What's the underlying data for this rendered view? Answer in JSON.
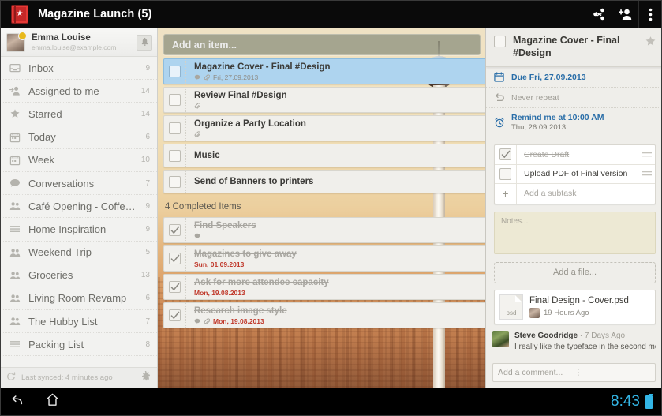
{
  "topbar": {
    "app_icon": "bookmark-star-icon",
    "title": "Magazine Launch (5)",
    "actions": [
      {
        "name": "share-icon",
        "label": "Share"
      },
      {
        "name": "add-person-icon",
        "label": "Add person"
      },
      {
        "name": "overflow-menu-icon",
        "label": "More options"
      }
    ]
  },
  "sidebar": {
    "profile": {
      "name": "Emma Louise",
      "email": "emma.louise@example.com",
      "notifications_icon": "bell-icon"
    },
    "items": [
      {
        "label": "Inbox",
        "count": "9",
        "icon": "inbox-icon"
      },
      {
        "label": "Assigned to me",
        "count": "14",
        "icon": "assigned-person-icon"
      },
      {
        "label": "Starred",
        "count": "14",
        "icon": "star-icon"
      },
      {
        "label": "Today",
        "count": "6",
        "icon": "calendar-icon"
      },
      {
        "label": "Week",
        "count": "10",
        "icon": "calendar-icon"
      },
      {
        "label": "Conversations",
        "count": "7",
        "icon": "chat-bubble-icon"
      },
      {
        "label": "Café Opening - Coffee S...",
        "count": "9",
        "icon": "people-icon"
      },
      {
        "label": "Home Inspiration",
        "count": "9",
        "icon": "list-icon"
      },
      {
        "label": "Weekend Trip",
        "count": "5",
        "icon": "people-icon"
      },
      {
        "label": "Groceries",
        "count": "13",
        "icon": "people-icon"
      },
      {
        "label": "Living Room Revamp",
        "count": "6",
        "icon": "people-icon"
      },
      {
        "label": "The Hubby List",
        "count": "7",
        "icon": "people-icon"
      },
      {
        "label": "Packing List",
        "count": "8",
        "icon": "list-icon"
      }
    ],
    "sync": {
      "icon": "refresh-icon",
      "text": "Last synced: 4 minutes ago",
      "settings_icon": "gear-icon"
    }
  },
  "list": {
    "add_item_placeholder": "Add an item...",
    "tasks": [
      {
        "title": "Magazine Cover - Final #Design",
        "date": "Fri, 27.09.2013",
        "selected": true,
        "has_comment": true,
        "has_attachment": true
      },
      {
        "title": "Review Final #Design",
        "date": "",
        "selected": false,
        "has_comment": false,
        "has_attachment": true
      },
      {
        "title": "Organize a Party Location",
        "date": "",
        "selected": false,
        "has_comment": false,
        "has_attachment": true
      },
      {
        "title": "Music",
        "date": "",
        "selected": false,
        "has_comment": false,
        "has_attachment": false
      },
      {
        "title": "Send of Banners to printers",
        "date": "",
        "selected": false,
        "has_comment": false,
        "has_attachment": false
      }
    ],
    "completed_header": "4 Completed Items",
    "completed": [
      {
        "title": "Find Speakers",
        "date": "",
        "has_comment": true,
        "has_attachment": false
      },
      {
        "title": "Magazines to give away",
        "date": "Sun, 01.09.2013",
        "has_comment": false,
        "has_attachment": false
      },
      {
        "title": "Ask for more attendee capacity",
        "date": "Mon, 19.08.2013",
        "has_comment": false,
        "has_attachment": false
      },
      {
        "title": "Research image style",
        "date": "Mon, 19.08.2013",
        "has_comment": true,
        "has_attachment": true
      }
    ]
  },
  "detail": {
    "title": "Magazine Cover - Final #Design",
    "star_icon": "star-icon",
    "due": {
      "icon": "calendar-icon",
      "text": "Due Fri, 27.09.2013"
    },
    "repeat": {
      "icon": "repeat-icon",
      "text": "Never repeat"
    },
    "reminder": {
      "icon": "alarm-clock-icon",
      "text": "Remind me at 10:00 AM",
      "sub": "Thu, 26.09.2013"
    },
    "subtasks": [
      {
        "label": "Create Draft",
        "done": true
      },
      {
        "label": "Upload PDF of Final version",
        "done": false
      }
    ],
    "add_subtask": "Add a subtask",
    "notes_placeholder": "Notes...",
    "add_file": "Add a file...",
    "file": {
      "ext": "psd",
      "name": "Final Design - Cover.psd",
      "time": "19 Hours Ago"
    },
    "comment": {
      "author": "Steve Goodridge",
      "separator": "·",
      "time": "7 Days Ago",
      "text": "I really like the typeface in the second mock-u.."
    },
    "comment_placeholder": "Add a comment..."
  },
  "sysbar": {
    "back_icon": "back-arrow-icon",
    "home_icon": "home-icon",
    "clock": "8:43",
    "battery_icon": "battery-full-icon"
  },
  "colors": {
    "accent_blue": "#33b5e5",
    "selected_row": "#aed4ef",
    "link_blue": "#2a6ea8",
    "overdue_red": "#c0392b",
    "app_red": "#c62828"
  }
}
